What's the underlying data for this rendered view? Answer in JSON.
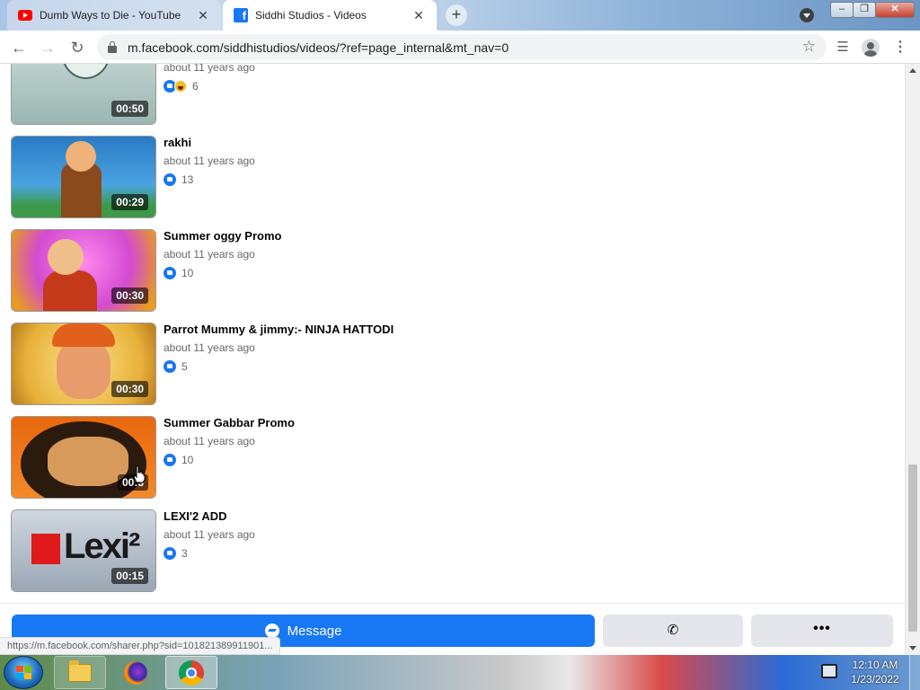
{
  "browser": {
    "tabs": [
      {
        "title": "Dumb Ways to Die - YouTube",
        "icon": "youtube-icon",
        "active": false
      },
      {
        "title": "Siddhi Studios - Videos",
        "icon": "facebook-icon",
        "active": true
      }
    ],
    "url": "m.facebook.com/siddhistudios/videos/?ref=page_internal&mt_nav=0",
    "status_url": "https://m.facebook.com/sharer.php?sid=101821389911901..."
  },
  "videos": [
    {
      "title": "",
      "date": "about 11 years ago",
      "reactions": "6",
      "duration": "00:50"
    },
    {
      "title": "rakhi",
      "date": "about 11 years ago",
      "reactions": "13",
      "duration": "00:29"
    },
    {
      "title": "Summer oggy Promo",
      "date": "about 11 years ago",
      "reactions": "10",
      "duration": "00:30"
    },
    {
      "title": "Parrot Mummy & jimmy:- NINJA HATTODI",
      "date": "about 11 years ago",
      "reactions": "5",
      "duration": "00:30"
    },
    {
      "title": "Summer Gabbar  Promo",
      "date": "about 11 years ago",
      "reactions": "10",
      "duration": "00:3"
    },
    {
      "title": "LEXI'2 ADD",
      "date": "about 11 years ago",
      "reactions": "3",
      "duration": "00:15"
    }
  ],
  "thumb_text": {
    "lexi": "Lexi²"
  },
  "actions": {
    "message_label": "Message",
    "call_icon": "phone-icon",
    "more_label": "•••"
  },
  "window_controls": {
    "minimize": "–",
    "maximize": "❐",
    "close": "✕"
  },
  "taskbar": {
    "time": "12:10 AM",
    "date": "1/23/2022"
  },
  "colors": {
    "facebook_blue": "#1877f2",
    "button_gray": "#e4e6eb",
    "meta_gray": "#65676b"
  }
}
